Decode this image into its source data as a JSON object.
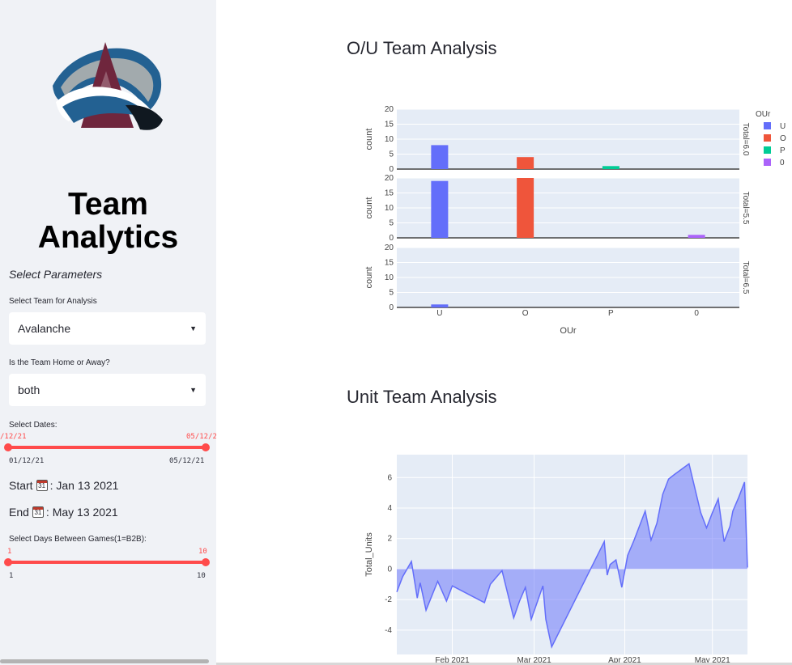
{
  "sidebar": {
    "app_title_line1": "Team",
    "app_title_line2": "Analytics",
    "params_heading": "Select Parameters",
    "team_label": "Select Team for Analysis",
    "team_value": "Avalanche",
    "home_label": "Is the Team Home or Away?",
    "home_value": "both",
    "dates_label": "Select Dates:",
    "date_slider": {
      "value_low": "/12/21",
      "value_high": "05/12/2",
      "min": "01/12/21",
      "max": "05/12/21"
    },
    "start_label": "Start",
    "start_value": ": Jan 13 2021",
    "end_label": "End",
    "end_value": ": May 13 2021",
    "days_label": "Select Days Between Games(1=B2B):",
    "days_slider": {
      "value_low": "1",
      "value_high": "10",
      "min": "1",
      "max": "10"
    },
    "calendar_icon_text": "31"
  },
  "main": {
    "ou_title": "O/U Team Analysis",
    "unit_title": "Unit Team Analysis"
  },
  "chart_data": [
    {
      "type": "bar",
      "title": "",
      "xlabel": "OUr",
      "ylabel": "count",
      "categories": [
        "U",
        "O",
        "P",
        "0"
      ],
      "ylim": [
        0,
        20
      ],
      "yticks": [
        0,
        5,
        10,
        15,
        20
      ],
      "legend_title": "OUr",
      "legend": [
        {
          "name": "U",
          "color": "#636efa"
        },
        {
          "name": "O",
          "color": "#ef553b"
        },
        {
          "name": "P",
          "color": "#00cc96"
        },
        {
          "name": "0",
          "color": "#ab63fa"
        }
      ],
      "facets": [
        {
          "label": "Total=6.0",
          "values": [
            8,
            4,
            1,
            0
          ]
        },
        {
          "label": "Total=5.5",
          "values": [
            19,
            20,
            0,
            1
          ]
        },
        {
          "label": "Total=6.5",
          "values": [
            1,
            0,
            0,
            0
          ]
        }
      ]
    },
    {
      "type": "area",
      "title": "",
      "xlabel": "",
      "ylabel": "Total_Units",
      "xlim": [
        "2021-01-13",
        "2021-05-13"
      ],
      "ylim": [
        -5.6,
        7.5
      ],
      "yticks": [
        -4,
        -2,
        0,
        2,
        4,
        6
      ],
      "xticks": [
        {
          "date": "2021-02-01",
          "label": "Feb 2021"
        },
        {
          "date": "2021-03-01",
          "label": "Mar 2021"
        },
        {
          "date": "2021-04-01",
          "label": "Apr 2021"
        },
        {
          "date": "2021-05-01",
          "label": "May 2021"
        }
      ],
      "color": "#636efa",
      "x": [
        "2021-01-13",
        "2021-01-15",
        "2021-01-18",
        "2021-01-20",
        "2021-01-21",
        "2021-01-23",
        "2021-01-27",
        "2021-01-30",
        "2021-02-01",
        "2021-02-12",
        "2021-02-14",
        "2021-02-18",
        "2021-02-22",
        "2021-02-24",
        "2021-02-26",
        "2021-02-28",
        "2021-03-02",
        "2021-03-04",
        "2021-03-05",
        "2021-03-07",
        "2021-03-25",
        "2021-03-26",
        "2021-03-27",
        "2021-03-29",
        "2021-03-31",
        "2021-04-02",
        "2021-04-04",
        "2021-04-06",
        "2021-04-08",
        "2021-04-10",
        "2021-04-12",
        "2021-04-14",
        "2021-04-16",
        "2021-04-18",
        "2021-04-23",
        "2021-04-27",
        "2021-04-29",
        "2021-05-01",
        "2021-05-03",
        "2021-05-05",
        "2021-05-07",
        "2021-05-08",
        "2021-05-10",
        "2021-05-12",
        "2021-05-13"
      ],
      "y": [
        -1.5,
        -0.5,
        0.5,
        -1.9,
        -0.9,
        -2.7,
        -0.8,
        -2.1,
        -1.1,
        -2.2,
        -1.0,
        -0.1,
        -3.2,
        -2.1,
        -1.2,
        -3.3,
        -2.2,
        -1.1,
        -3.3,
        -5.1,
        1.8,
        -0.4,
        0.3,
        0.6,
        -1.2,
        0.9,
        1.8,
        2.8,
        3.8,
        1.9,
        3.0,
        4.9,
        5.9,
        6.2,
        6.9,
        3.7,
        2.7,
        3.7,
        4.6,
        1.8,
        2.8,
        3.8,
        4.7,
        5.7,
        0.1
      ]
    }
  ]
}
